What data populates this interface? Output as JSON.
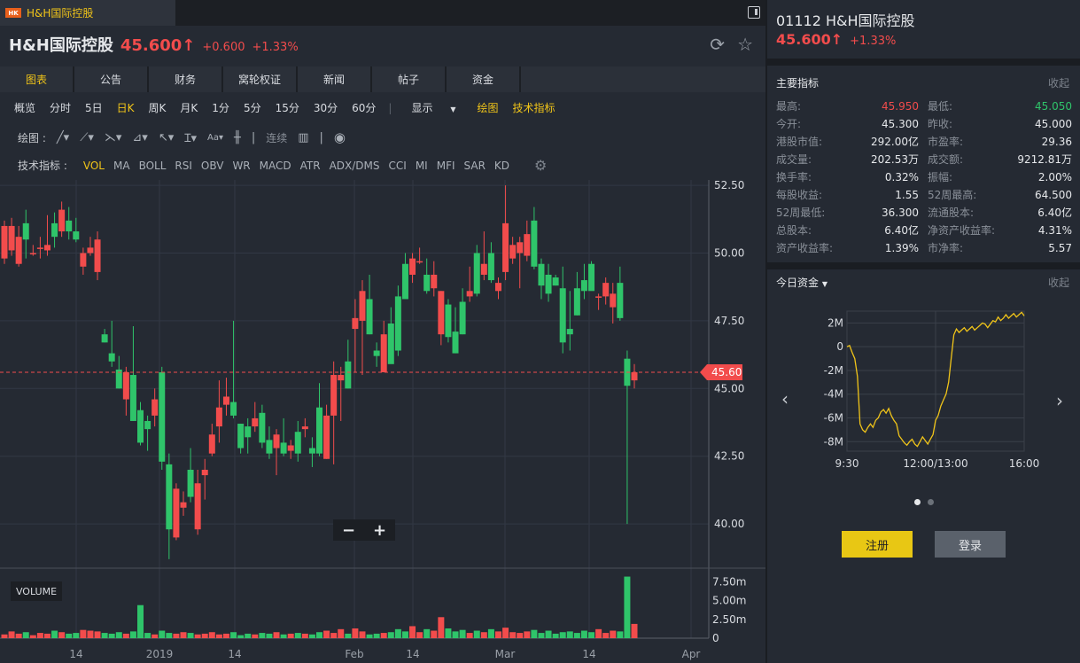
{
  "tab": {
    "badge": "HK",
    "title": "H&H国际控股"
  },
  "header": {
    "name": "H&H国际控股",
    "price": "45.600↑",
    "change": "+0.600",
    "change_pct": "+1.33%"
  },
  "nav_tabs": [
    "图表",
    "公告",
    "财务",
    "窝轮权证",
    "新闻",
    "帖子",
    "资金"
  ],
  "periods": [
    "概览",
    "分时",
    "5日",
    "日K",
    "周K",
    "月K",
    "1分",
    "5分",
    "15分",
    "30分",
    "60分"
  ],
  "period_active": "日K",
  "display_menu": "显示",
  "draw_label": "绘图",
  "tech_indicator_label": "技术指标",
  "drawbar": {
    "label": "绘图 :",
    "continuous": "连续"
  },
  "indicators": {
    "label": "技术指标 :",
    "items": [
      "VOL",
      "MA",
      "BOLL",
      "RSI",
      "OBV",
      "WR",
      "MACD",
      "ATR",
      "ADX/DMS",
      "CCI",
      "MI",
      "MFI",
      "SAR",
      "KD"
    ],
    "active": "VOL"
  },
  "zoom": {
    "minus": "−",
    "plus": "+"
  },
  "volume_label": "VOLUME",
  "colors": {
    "up": "#f24c4c",
    "down": "#2fc46a",
    "accent": "#f0c419",
    "bg": "#252a33"
  },
  "chart_data": {
    "type": "candlestick",
    "price_ticks": [
      "52.50",
      "50.00",
      "47.50",
      "45.00",
      "42.50",
      "40.00"
    ],
    "ylim": [
      38.4,
      52.7
    ],
    "last_price": "45.60",
    "volume_ticks": [
      "7.50m",
      "5.00m",
      "2.50m",
      "0"
    ],
    "volume_ylim": [
      0,
      8.5
    ],
    "x_ticks": [
      "14",
      "2019",
      "14",
      "Feb",
      "14",
      "Mar",
      "14",
      "Apr"
    ],
    "candles": [
      {
        "o": 49.8,
        "h": 51.2,
        "l": 49.6,
        "c": 51.0
      },
      {
        "o": 50.1,
        "h": 51.3,
        "l": 49.9,
        "c": 51.0
      },
      {
        "o": 49.6,
        "h": 51.0,
        "l": 49.5,
        "c": 50.6
      },
      {
        "o": 51.1,
        "h": 51.6,
        "l": 49.8,
        "c": 50.5
      },
      {
        "o": 50.0,
        "h": 50.3,
        "l": 49.9,
        "c": 50.0
      },
      {
        "o": 50.2,
        "h": 50.6,
        "l": 49.8,
        "c": 50.2
      },
      {
        "o": 50.1,
        "h": 51.4,
        "l": 49.9,
        "c": 50.3
      },
      {
        "o": 51.1,
        "h": 51.5,
        "l": 50.2,
        "c": 50.6
      },
      {
        "o": 50.8,
        "h": 51.9,
        "l": 50.6,
        "c": 51.6
      },
      {
        "o": 51.2,
        "h": 51.7,
        "l": 50.5,
        "c": 50.8
      },
      {
        "o": 50.8,
        "h": 51.3,
        "l": 50.4,
        "c": 50.5
      },
      {
        "o": 49.5,
        "h": 50.2,
        "l": 49.2,
        "c": 50.0
      },
      {
        "o": 50.0,
        "h": 50.6,
        "l": 49.9,
        "c": 50.2
      },
      {
        "o": 49.3,
        "h": 50.8,
        "l": 49.0,
        "c": 50.5
      },
      {
        "o": 47.0,
        "h": 47.2,
        "l": 46.7,
        "c": 46.7
      },
      {
        "o": 46.3,
        "h": 47.5,
        "l": 45.8,
        "c": 46.0
      },
      {
        "o": 45.7,
        "h": 46.2,
        "l": 45.0,
        "c": 45.0
      },
      {
        "o": 44.6,
        "h": 45.8,
        "l": 44.0,
        "c": 45.6
      },
      {
        "o": 45.5,
        "h": 47.3,
        "l": 43.8,
        "c": 43.8
      },
      {
        "o": 44.2,
        "h": 44.5,
        "l": 42.9,
        "c": 43.0
      },
      {
        "o": 43.8,
        "h": 44.0,
        "l": 42.7,
        "c": 43.5
      },
      {
        "o": 44.0,
        "h": 45.0,
        "l": 43.6,
        "c": 44.6
      },
      {
        "o": 45.6,
        "h": 45.8,
        "l": 42.0,
        "c": 42.3
      },
      {
        "o": 42.2,
        "h": 42.6,
        "l": 38.7,
        "c": 39.8
      },
      {
        "o": 39.5,
        "h": 41.5,
        "l": 39.4,
        "c": 41.3
      },
      {
        "o": 40.6,
        "h": 41.2,
        "l": 40.3,
        "c": 40.8
      },
      {
        "o": 42.0,
        "h": 42.8,
        "l": 40.8,
        "c": 41.0
      },
      {
        "o": 39.8,
        "h": 42.0,
        "l": 39.6,
        "c": 41.5
      },
      {
        "o": 41.8,
        "h": 42.4,
        "l": 40.9,
        "c": 42.0
      },
      {
        "o": 42.6,
        "h": 43.7,
        "l": 42.5,
        "c": 43.3
      },
      {
        "o": 43.6,
        "h": 45.3,
        "l": 43.0,
        "c": 44.3
      },
      {
        "o": 44.4,
        "h": 45.4,
        "l": 44.0,
        "c": 44.7
      },
      {
        "o": 44.5,
        "h": 47.5,
        "l": 43.9,
        "c": 44.0
      },
      {
        "o": 43.7,
        "h": 43.7,
        "l": 42.6,
        "c": 42.8
      },
      {
        "o": 43.6,
        "h": 43.9,
        "l": 42.6,
        "c": 43.2
      },
      {
        "o": 43.6,
        "h": 44.5,
        "l": 43.4,
        "c": 43.9
      },
      {
        "o": 44.1,
        "h": 44.4,
        "l": 42.8,
        "c": 43.0
      },
      {
        "o": 43.1,
        "h": 43.6,
        "l": 42.4,
        "c": 42.6
      },
      {
        "o": 42.8,
        "h": 43.5,
        "l": 41.8,
        "c": 43.3
      },
      {
        "o": 43.0,
        "h": 43.9,
        "l": 42.5,
        "c": 42.6
      },
      {
        "o": 42.7,
        "h": 43.1,
        "l": 42.4,
        "c": 42.9
      },
      {
        "o": 43.4,
        "h": 43.8,
        "l": 42.3,
        "c": 42.6
      },
      {
        "o": 43.5,
        "h": 43.9,
        "l": 43.2,
        "c": 43.6
      },
      {
        "o": 42.8,
        "h": 43.2,
        "l": 42.1,
        "c": 42.6
      },
      {
        "o": 44.3,
        "h": 45.2,
        "l": 42.5,
        "c": 42.6
      },
      {
        "o": 42.4,
        "h": 44.4,
        "l": 42.4,
        "c": 44.0
      },
      {
        "o": 44.0,
        "h": 46.0,
        "l": 42.2,
        "c": 45.5
      },
      {
        "o": 45.3,
        "h": 45.8,
        "l": 43.8,
        "c": 45.5
      },
      {
        "o": 46.0,
        "h": 46.8,
        "l": 45.0,
        "c": 45.0
      },
      {
        "o": 47.2,
        "h": 48.3,
        "l": 45.6,
        "c": 47.6
      },
      {
        "o": 47.5,
        "h": 49.0,
        "l": 45.5,
        "c": 48.6
      },
      {
        "o": 48.3,
        "h": 49.2,
        "l": 47.0,
        "c": 47.0
      },
      {
        "o": 46.4,
        "h": 46.7,
        "l": 45.8,
        "c": 46.2
      },
      {
        "o": 45.6,
        "h": 47.5,
        "l": 45.6,
        "c": 47.0
      },
      {
        "o": 47.4,
        "h": 48.0,
        "l": 46.0,
        "c": 45.9
      },
      {
        "o": 48.4,
        "h": 48.8,
        "l": 46.2,
        "c": 46.4
      },
      {
        "o": 49.6,
        "h": 50.0,
        "l": 48.4,
        "c": 48.3
      },
      {
        "o": 49.2,
        "h": 50.0,
        "l": 48.9,
        "c": 49.8
      },
      {
        "o": 49.7,
        "h": 50.2,
        "l": 49.6,
        "c": 49.7
      },
      {
        "o": 49.2,
        "h": 49.8,
        "l": 48.5,
        "c": 48.6
      },
      {
        "o": 48.7,
        "h": 49.7,
        "l": 48.4,
        "c": 49.2
      },
      {
        "o": 47.0,
        "h": 48.6,
        "l": 46.6,
        "c": 48.6
      },
      {
        "o": 48.1,
        "h": 48.3,
        "l": 46.7,
        "c": 46.9
      },
      {
        "o": 47.1,
        "h": 48.0,
        "l": 46.3,
        "c": 46.3
      },
      {
        "o": 48.2,
        "h": 48.7,
        "l": 47.0,
        "c": 47.0
      },
      {
        "o": 48.4,
        "h": 49.5,
        "l": 48.2,
        "c": 48.6
      },
      {
        "o": 50.0,
        "h": 50.3,
        "l": 48.4,
        "c": 48.5
      },
      {
        "o": 49.2,
        "h": 50.8,
        "l": 49.0,
        "c": 49.6
      },
      {
        "o": 50.0,
        "h": 50.4,
        "l": 48.9,
        "c": 49.0
      },
      {
        "o": 48.6,
        "h": 49.1,
        "l": 48.3,
        "c": 48.9
      },
      {
        "o": 49.3,
        "h": 52.5,
        "l": 49.0,
        "c": 51.1
      },
      {
        "o": 49.8,
        "h": 50.6,
        "l": 49.6,
        "c": 50.3
      },
      {
        "o": 50.0,
        "h": 50.6,
        "l": 48.7,
        "c": 50.4
      },
      {
        "o": 49.9,
        "h": 51.2,
        "l": 49.7,
        "c": 50.7
      },
      {
        "o": 51.2,
        "h": 51.7,
        "l": 49.4,
        "c": 49.5
      },
      {
        "o": 49.6,
        "h": 49.8,
        "l": 48.3,
        "c": 48.8
      },
      {
        "o": 49.2,
        "h": 49.6,
        "l": 48.2,
        "c": 48.5
      },
      {
        "o": 49.1,
        "h": 49.2,
        "l": 48.8,
        "c": 48.8
      },
      {
        "o": 48.7,
        "h": 49.5,
        "l": 46.3,
        "c": 46.7
      },
      {
        "o": 47.2,
        "h": 48.6,
        "l": 46.4,
        "c": 47.0
      },
      {
        "o": 48.7,
        "h": 49.3,
        "l": 47.7,
        "c": 47.7
      },
      {
        "o": 49.0,
        "h": 49.6,
        "l": 48.3,
        "c": 48.6
      },
      {
        "o": 49.6,
        "h": 49.7,
        "l": 48.7,
        "c": 48.6
      },
      {
        "o": 48.4,
        "h": 48.5,
        "l": 47.9,
        "c": 48.4
      },
      {
        "o": 48.4,
        "h": 49.1,
        "l": 48.1,
        "c": 48.9
      },
      {
        "o": 48.0,
        "h": 48.9,
        "l": 47.4,
        "c": 48.5
      },
      {
        "o": 48.9,
        "h": 49.5,
        "l": 47.5,
        "c": 47.6
      },
      {
        "o": 46.1,
        "h": 46.4,
        "l": 40.0,
        "c": 45.1
      },
      {
        "o": 45.3,
        "h": 45.9,
        "l": 45.0,
        "c": 45.6
      }
    ],
    "volumes": [
      0.5,
      0.9,
      0.6,
      0.8,
      0.4,
      0.7,
      0.6,
      1.0,
      0.8,
      0.6,
      0.7,
      1.1,
      1.0,
      0.9,
      0.7,
      0.6,
      0.8,
      0.6,
      0.9,
      4.4,
      0.7,
      0.5,
      1.0,
      0.7,
      0.6,
      0.8,
      0.7,
      0.5,
      0.6,
      0.8,
      0.5,
      0.6,
      0.8,
      0.4,
      0.6,
      0.5,
      0.7,
      0.6,
      0.8,
      0.5,
      0.6,
      0.7,
      0.6,
      0.5,
      0.8,
      1.0,
      0.7,
      1.2,
      0.6,
      1.3,
      0.9,
      0.5,
      0.6,
      0.7,
      0.8,
      1.2,
      0.9,
      1.6,
      0.8,
      1.2,
      1.0,
      2.8,
      1.3,
      0.9,
      1.1,
      0.7,
      1.0,
      0.8,
      1.2,
      0.9,
      1.4,
      0.8,
      0.7,
      0.9,
      1.1,
      0.7,
      1.0,
      0.6,
      0.8,
      0.9,
      0.7,
      1.0,
      0.8,
      1.2,
      0.7,
      1.0,
      0.9,
      8.2,
      1.9
    ]
  },
  "right": {
    "code": "01112 H&H国际控股",
    "price": "45.600↑",
    "change_pct": "+1.33%",
    "metrics_title": "主要指标",
    "collapse": "收起",
    "metrics": [
      {
        "l1": "最高:",
        "v1": "45.950",
        "c1": "red",
        "l2": "最低:",
        "v2": "45.050",
        "c2": "green"
      },
      {
        "l1": "今开:",
        "v1": "45.300",
        "c1": "",
        "l2": "昨收:",
        "v2": "45.000",
        "c2": ""
      },
      {
        "l1": "港股市值:",
        "v1": "292.00亿",
        "c1": "",
        "l2": "市盈率:",
        "v2": "29.36",
        "c2": ""
      },
      {
        "l1": "成交量:",
        "v1": "202.53万",
        "c1": "",
        "l2": "成交额:",
        "v2": "9212.81万",
        "c2": ""
      },
      {
        "l1": "换手率:",
        "v1": "0.32%",
        "c1": "",
        "l2": "振幅:",
        "v2": "2.00%",
        "c2": ""
      },
      {
        "l1": "每股收益:",
        "v1": "1.55",
        "c1": "",
        "l2": "52周最高:",
        "v2": "64.500",
        "c2": ""
      },
      {
        "l1": "52周最低:",
        "v1": "36.300",
        "c1": "",
        "l2": "流通股本:",
        "v2": "6.40亿",
        "c2": ""
      },
      {
        "l1": "总股本:",
        "v1": "6.40亿",
        "c1": "",
        "l2": "净资产收益率:",
        "v2": "4.31%",
        "c2": ""
      },
      {
        "l1": "资产收益率:",
        "v1": "1.39%",
        "c1": "",
        "l2": "市净率:",
        "v2": "5.57",
        "c2": ""
      }
    ],
    "fund_title": "今日资金",
    "fund_chart": {
      "y_ticks": [
        "2M",
        "0",
        "-2M",
        "-4M",
        "-6M",
        "-8M"
      ],
      "x_ticks": [
        "9:30",
        "12:00/13:00",
        "16:00"
      ],
      "ylim": [
        -8.8,
        3.0
      ],
      "series": [
        0.0,
        0.1,
        -0.5,
        -1.0,
        -2.5,
        -6.5,
        -7.0,
        -7.2,
        -6.8,
        -6.5,
        -6.8,
        -6.2,
        -6.0,
        -5.5,
        -5.3,
        -5.6,
        -5.2,
        -5.8,
        -6.2,
        -6.5,
        -7.5,
        -7.8,
        -8.1,
        -8.3,
        -8.0,
        -7.8,
        -8.2,
        -8.4,
        -8.0,
        -7.6,
        -7.9,
        -8.2,
        -7.8,
        -7.4,
        -6.2,
        -5.8,
        -5.0,
        -4.5,
        -4.0,
        -3.0,
        -1.0,
        1.0,
        1.5,
        1.2,
        1.4,
        1.6,
        1.3,
        1.5,
        1.7,
        1.4,
        1.6,
        1.8,
        2.0,
        1.9,
        1.6,
        1.9,
        2.2,
        2.1,
        2.5,
        2.2,
        2.4,
        2.7,
        2.4,
        2.6,
        2.8,
        2.5,
        2.7,
        2.9,
        2.6
      ]
    },
    "register": "注册",
    "login": "登录"
  }
}
